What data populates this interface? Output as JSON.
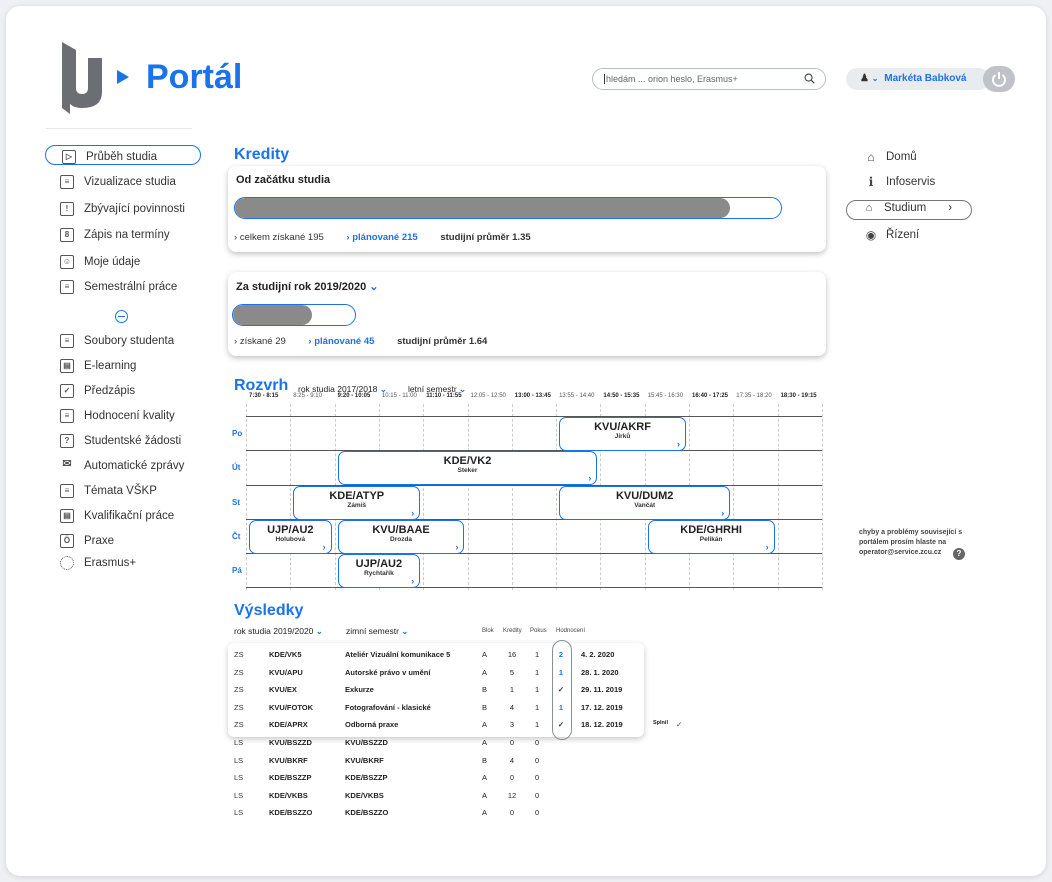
{
  "header": {
    "app_title": "Portál",
    "search_placeholder": "hledám ... orion heslo, Erasmus+",
    "user_name": "Markéta Babková",
    "user_icon": "user-icon",
    "power_icon": "power-icon"
  },
  "sidebar": {
    "items": [
      {
        "label": "Průběh studia",
        "icon": "progress-icon"
      },
      {
        "label": "Vizualizace studia",
        "icon": "chart-doc-icon"
      },
      {
        "label": "Zbývající povinnosti",
        "icon": "exclamation-icon"
      },
      {
        "label": "Zápis na termíny",
        "icon": "calendar-icon"
      },
      {
        "label": "Moje údaje",
        "icon": "person-card-icon"
      },
      {
        "label": "Semestrální práce",
        "icon": "document-icon"
      },
      {
        "label": "Soubory studenta",
        "icon": "files-icon"
      },
      {
        "label": "E-learning",
        "icon": "elearning-icon"
      },
      {
        "label": "Předzápis",
        "icon": "check-doc-icon"
      },
      {
        "label": "Hodnocení kvality",
        "icon": "rating-icon"
      },
      {
        "label": "Studentské žádosti",
        "icon": "question-doc-icon"
      },
      {
        "label": "Automatické zprávy",
        "icon": "mail-icon"
      },
      {
        "label": "Témata VŠKP",
        "icon": "list-doc-icon"
      },
      {
        "label": "Kvalifikační práce",
        "icon": "thesis-icon"
      },
      {
        "label": "Praxe",
        "icon": "flask-icon"
      },
      {
        "label": "Erasmus+",
        "icon": "loading-circle-icon"
      }
    ]
  },
  "right_nav": {
    "items": [
      {
        "label": "Domů",
        "icon": "home-icon"
      },
      {
        "label": "Infoservis",
        "icon": "info-icon"
      },
      {
        "label": "Studium",
        "icon": "graduation-cap-icon",
        "chevron": "›"
      },
      {
        "label": "Řízení",
        "icon": "radio-icon"
      }
    ],
    "help_text": "chyby a problémy související s portálem prosím hlaste na operator@service.zcu.cz",
    "help_badge": "?"
  },
  "credits": {
    "title": "Kredity",
    "total": {
      "title": "Od začátku studia",
      "earned": "celkem získané 195",
      "planned": "plánované 215",
      "average": "studijní průměr 1.35",
      "progress": 0.907
    },
    "year": {
      "title": "Za studijní rok 2019/2020",
      "earned": "získané 29",
      "planned": "plánované 45",
      "average": "studijní průměr 1.64",
      "progress": 0.644
    }
  },
  "timetable": {
    "title": "Rozvrh",
    "year_select": "rok studia 2017/2018",
    "semester_select": "letní semestr",
    "slots": [
      {
        "label": "7:30 - 8:15",
        "bold": true
      },
      {
        "label": "8:25 - 9:10",
        "bold": false
      },
      {
        "label": "9:20 - 10:05",
        "bold": true
      },
      {
        "label": "10:15 - 11:00",
        "bold": false
      },
      {
        "label": "11:10 - 11:55",
        "bold": true
      },
      {
        "label": "12:05 - 12:50",
        "bold": false
      },
      {
        "label": "13:00 - 13:45",
        "bold": true
      },
      {
        "label": "13:55 - 14:40",
        "bold": false
      },
      {
        "label": "14:50 - 15:35",
        "bold": true
      },
      {
        "label": "15:45 - 16:30",
        "bold": false
      },
      {
        "label": "16:40 - 17:25",
        "bold": true
      },
      {
        "label": "17:35 - 18:20",
        "bold": false
      },
      {
        "label": "18:30 - 19:15",
        "bold": true
      }
    ],
    "days": [
      "Po",
      "Út",
      "St",
      "Čt",
      "Pá"
    ],
    "events": [
      {
        "code": "KVU/AKRF",
        "teacher": "Jirků",
        "day": 0,
        "start": 7,
        "span": 3
      },
      {
        "code": "KDE/VK2",
        "teacher": "Steker",
        "day": 1,
        "start": 2,
        "span": 6
      },
      {
        "code": "KDE/ATYP",
        "teacher": "Zámiš",
        "day": 2,
        "start": 1,
        "span": 3
      },
      {
        "code": "KVU/DUM2",
        "teacher": "Vančát",
        "day": 2,
        "start": 7,
        "span": 4
      },
      {
        "code": "UJP/AU2",
        "teacher": "Holubová",
        "day": 3,
        "start": 0,
        "span": 2
      },
      {
        "code": "KVU/BAAE",
        "teacher": "Drozda",
        "day": 3,
        "start": 2,
        "span": 3
      },
      {
        "code": "KDE/GHRHI",
        "teacher": "Pelikán",
        "day": 3,
        "start": 9,
        "span": 3
      },
      {
        "code": "UJP/AU2",
        "teacher": "Rychtařík",
        "day": 4,
        "start": 2,
        "span": 2
      }
    ],
    "arrow": "›"
  },
  "results": {
    "title": "Výsledky",
    "year_select": "rok studia 2019/2020",
    "semester_select": "zimní semestr",
    "columns": {
      "block": "Blok",
      "credits": "Kredity",
      "attempt": "Pokus",
      "grade": "Hodnocení"
    },
    "rows": [
      {
        "sem": "ZS",
        "code": "KDE/VK5",
        "name": "Ateliér Vizuální komunikace 5",
        "block": "A",
        "credits": "16",
        "attempt": "1",
        "grade": "2",
        "date": "4. 2. 2020",
        "note": "",
        "ok": ""
      },
      {
        "sem": "ZS",
        "code": "KVU/APU",
        "name": "Autorské právo v umění",
        "block": "A",
        "credits": "5",
        "attempt": "1",
        "grade": "1",
        "date": "28. 1. 2020",
        "note": "",
        "ok": ""
      },
      {
        "sem": "ZS",
        "code": "KVU/EX",
        "name": "Exkurze",
        "block": "B",
        "credits": "1",
        "attempt": "1",
        "grade": "✓",
        "date": "29. 11. 2019",
        "note": "",
        "ok": ""
      },
      {
        "sem": "ZS",
        "code": "KVU/FOTOK",
        "name": "Fotografování - klasické",
        "block": "B",
        "credits": "4",
        "attempt": "1",
        "grade": "1",
        "date": "17. 12. 2019",
        "note": "",
        "ok": ""
      },
      {
        "sem": "ZS",
        "code": "KDE/APRX",
        "name": "Odborná praxe",
        "block": "A",
        "credits": "3",
        "attempt": "1",
        "grade": "✓",
        "date": "18. 12. 2019",
        "note": "Splnil",
        "ok": "✓"
      },
      {
        "sem": "LS",
        "code": "KVU/BSZZD",
        "name": "KVU/BSZZD",
        "block": "A",
        "credits": "0",
        "attempt": "0",
        "grade": "",
        "date": "",
        "note": "",
        "ok": ""
      },
      {
        "sem": "LS",
        "code": "KVU/BKRF",
        "name": "KVU/BKRF",
        "block": "B",
        "credits": "4",
        "attempt": "0",
        "grade": "",
        "date": "",
        "note": "",
        "ok": ""
      },
      {
        "sem": "LS",
        "code": "KDE/BSZZP",
        "name": "KDE/BSZZP",
        "block": "A",
        "credits": "0",
        "attempt": "0",
        "grade": "",
        "date": "",
        "note": "",
        "ok": ""
      },
      {
        "sem": "LS",
        "code": "KDE/VKBS",
        "name": "KDE/VKBS",
        "block": "A",
        "credits": "12",
        "attempt": "0",
        "grade": "",
        "date": "",
        "note": "",
        "ok": ""
      },
      {
        "sem": "LS",
        "code": "KDE/BSZZO",
        "name": "KDE/BSZZO",
        "block": "A",
        "credits": "0",
        "attempt": "0",
        "grade": "",
        "date": "",
        "note": "",
        "ok": ""
      }
    ]
  },
  "colors": {
    "accent": "#1a73e8",
    "bar_fill": "#8a8a8a"
  }
}
